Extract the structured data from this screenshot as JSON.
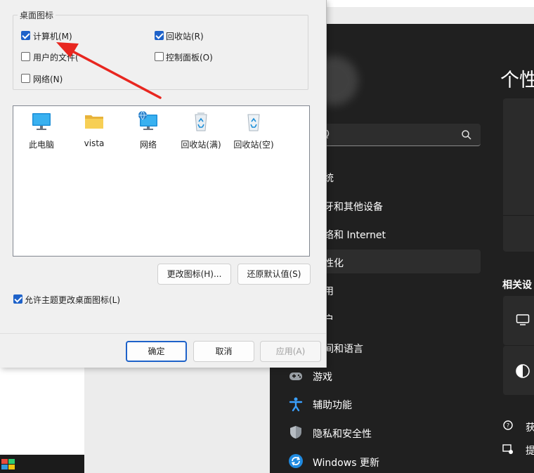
{
  "dialog": {
    "group_title": "桌面图标",
    "checkboxes": [
      {
        "label": "计算机(M)",
        "checked": true
      },
      {
        "label": "回收站(R)",
        "checked": true
      },
      {
        "label": "用户的文件(",
        "checked": false
      },
      {
        "label": "控制面板(O)",
        "checked": false
      },
      {
        "label": "网络(N)",
        "checked": false
      }
    ],
    "icons": [
      {
        "caption": "此电脑",
        "icon": "monitor-icon"
      },
      {
        "caption": "vista",
        "icon": "folder-icon"
      },
      {
        "caption": "网络",
        "icon": "network-monitor-icon"
      },
      {
        "caption": "回收站(满)",
        "icon": "recycle-bin-full-icon"
      },
      {
        "caption": "回收站(空)",
        "icon": "recycle-bin-empty-icon"
      }
    ],
    "change_icon_button": "更改图标(H)...",
    "restore_default_button": "还原默认值(S)",
    "allow_themes": {
      "label": "允许主题更改桌面图标(L)",
      "checked": true
    },
    "ok_button": "确定",
    "cancel_button": "取消",
    "apply_button": "应用(A)"
  },
  "settings": {
    "page_title_partial": "个性",
    "search_partial": "Q",
    "nav_partial": [
      "统",
      "牙和其他设备",
      "络和 Internet",
      "性化",
      "用",
      "户",
      "间和语言"
    ],
    "nav_full": [
      {
        "label": "游戏",
        "icon": "game-controller-icon"
      },
      {
        "label": "辅助功能",
        "icon": "accessibility-icon"
      },
      {
        "label": "隐私和安全性",
        "icon": "shield-icon"
      },
      {
        "label": "Windows 更新",
        "icon": "windows-update-icon"
      }
    ],
    "related_title": "相关设",
    "bottom_links": [
      "获",
      "提"
    ]
  },
  "colors": {
    "accent": "#1e62c9",
    "settings_bg": "#202020",
    "dialog_bg": "#f0f0f0",
    "arrow": "#e8261f"
  }
}
